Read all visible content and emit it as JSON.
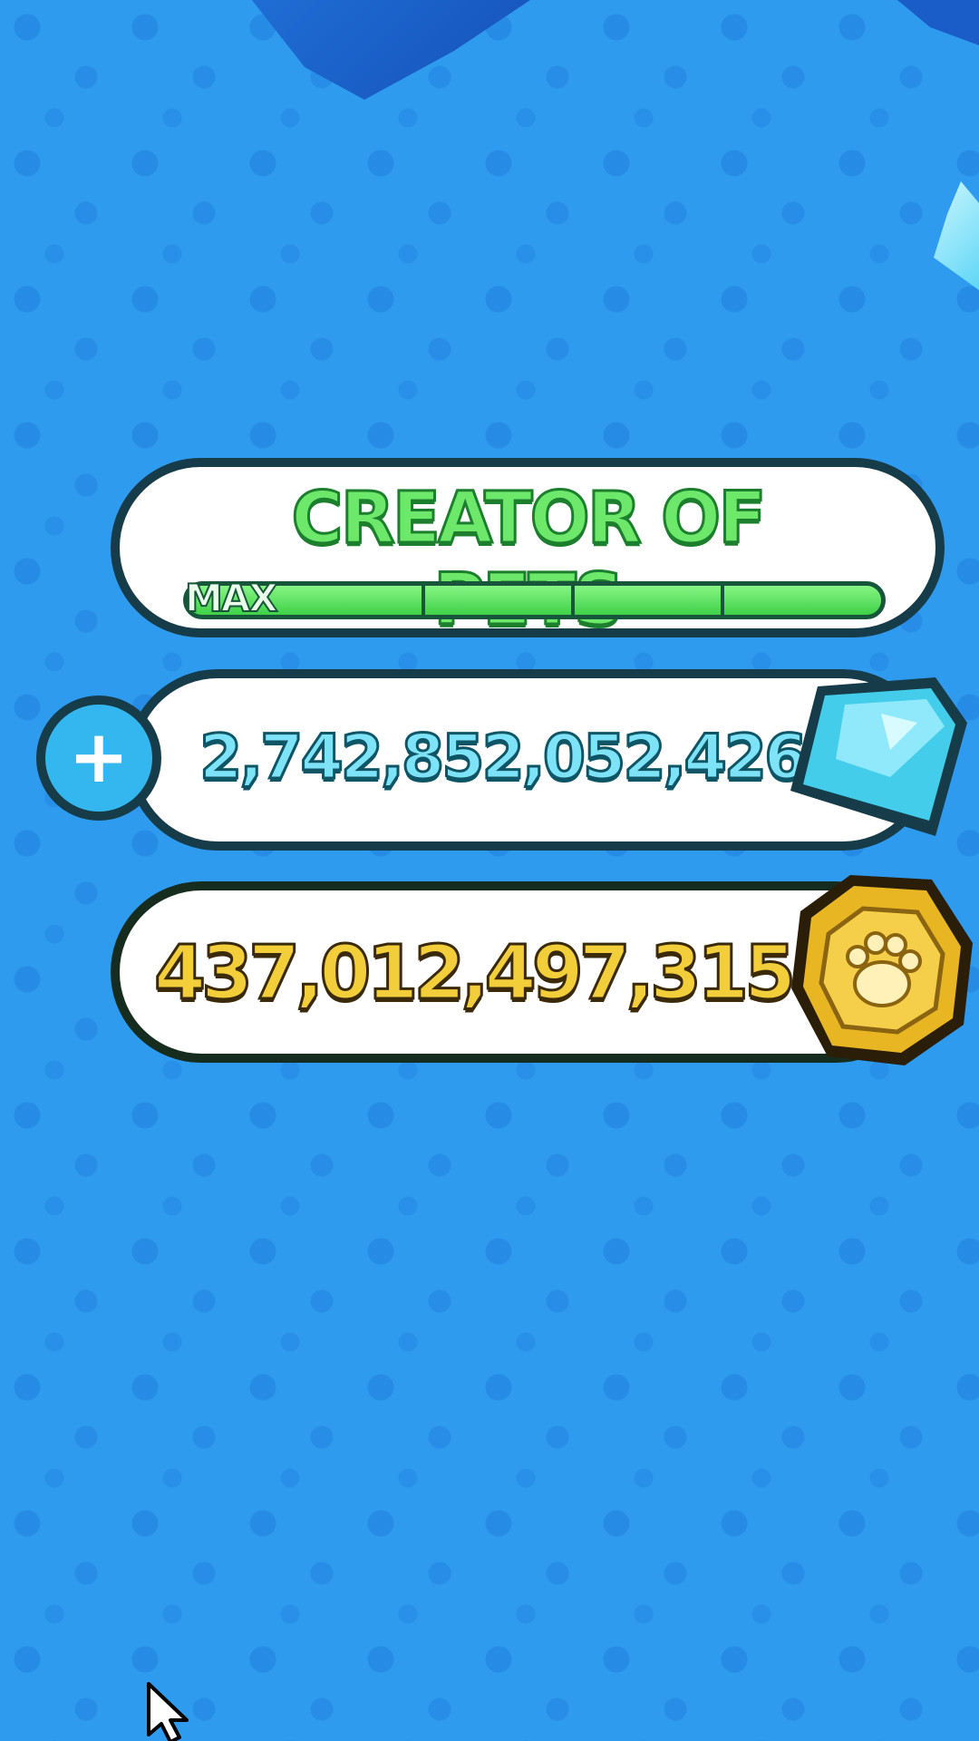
{
  "rank": {
    "title": "CREATOR OF PETS",
    "progress_label": "MAX",
    "progress": 1.0
  },
  "currencies": {
    "gems": {
      "value": "2,742,852,052,426",
      "icon": "diamond-icon",
      "add_icon": "plus-icon"
    },
    "coins": {
      "value": "437,012,497,315",
      "icon": "paw-coin-icon"
    }
  },
  "colors": {
    "background": "#2f9bef",
    "rank_text": "#6ee86b",
    "gems_text": "#7fe3f7",
    "coins_text": "#f2cf3a",
    "panel_border": "#163c4a"
  }
}
